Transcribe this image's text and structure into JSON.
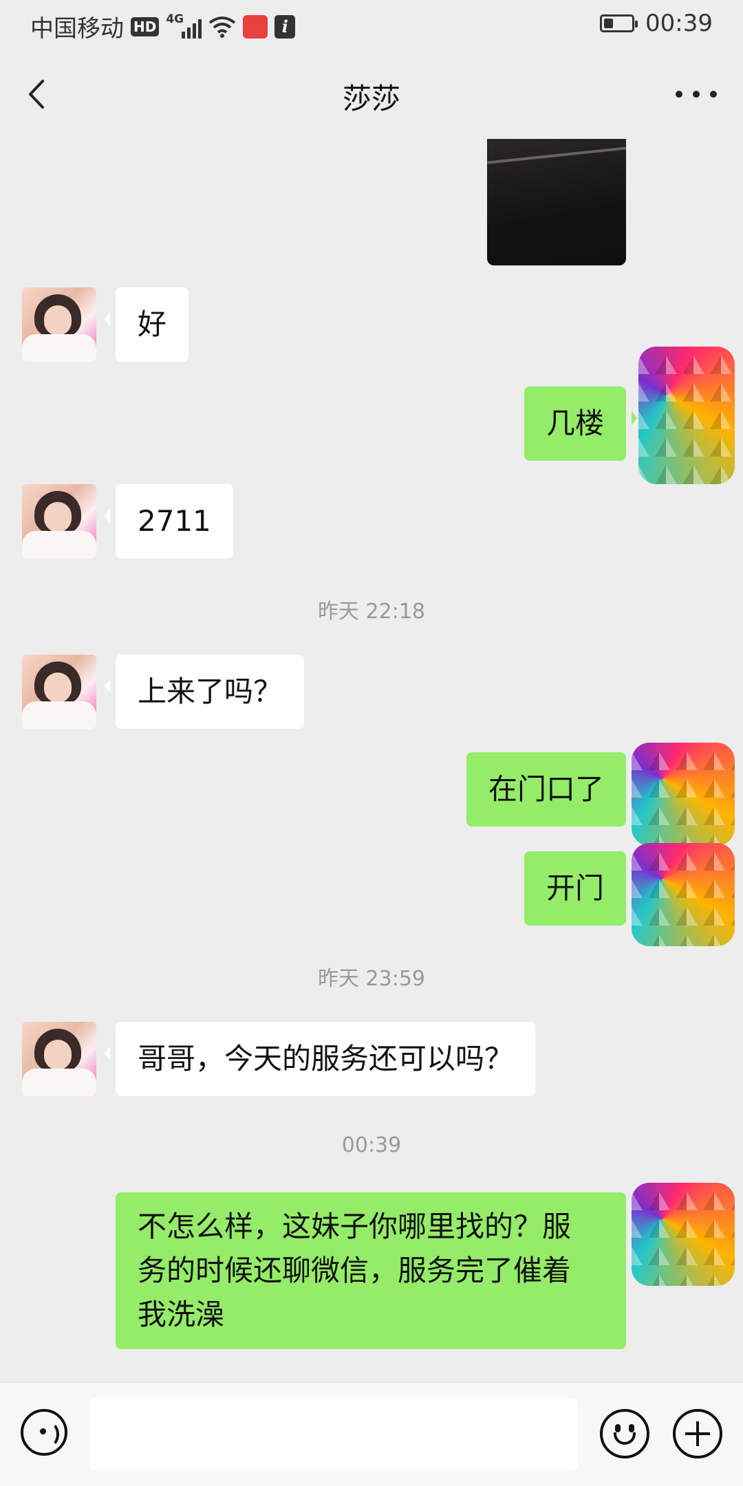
{
  "status_bar": {
    "carrier": "中国移动",
    "hd": "HD",
    "network": "4G",
    "time": "00:39",
    "battery_level": 0.35
  },
  "header": {
    "title": "莎莎"
  },
  "messages": [
    {
      "from": "contact",
      "text": "好"
    },
    {
      "from": "me",
      "text": "几楼"
    },
    {
      "from": "contact",
      "text": "2711"
    },
    {
      "from": "contact",
      "text": "上来了吗？"
    },
    {
      "from": "me",
      "text": "在门口了"
    },
    {
      "from": "me",
      "text": "开门"
    },
    {
      "from": "contact",
      "text": "哥哥，今天的服务还可以吗？"
    },
    {
      "from": "me",
      "lines": [
        "不怎么样，这妹子你哪里找的？服",
        "务的时候还聊微信，服务完了催着",
        "我洗澡"
      ]
    }
  ],
  "timestamps": [
    "昨天 22:18",
    "昨天 23:59",
    "00:39"
  ],
  "colors": {
    "background": "#ededed",
    "outgoing_bubble": "#95ec69",
    "incoming_bubble": "#ffffff",
    "timestamp": "#999999"
  },
  "icons": {
    "back": "chevron-left-icon",
    "more": "ellipsis-icon",
    "voice": "voice-icon",
    "emoji": "emoji-icon",
    "plus": "plus-icon"
  }
}
